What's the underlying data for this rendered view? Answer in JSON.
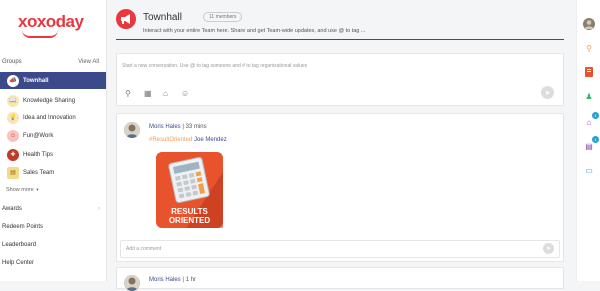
{
  "brand": {
    "logo_text": "xoxoday"
  },
  "sidebar": {
    "groups_label": "Groups",
    "view_all": "View All",
    "groups": [
      {
        "label": "Townhall",
        "active": true,
        "color": "#e8383d",
        "icon": "megaphone-icon"
      },
      {
        "label": "Knowledge Sharing",
        "active": false,
        "color": "#f5c542",
        "icon": "book-icon"
      },
      {
        "label": "Idea and Innovation",
        "active": false,
        "color": "#f39c12",
        "icon": "lightbulb-icon"
      },
      {
        "label": "Fun@Work",
        "active": false,
        "color": "#e74c3c",
        "icon": "fun-icon"
      },
      {
        "label": "Health Tips",
        "active": false,
        "color": "#c0392b",
        "icon": "health-icon"
      },
      {
        "label": "Sales Team",
        "active": false,
        "color": "#d4a017",
        "icon": "sales-icon"
      }
    ],
    "show_more": "Show more",
    "links": [
      "Awards",
      "Redeem Points",
      "Leaderboard",
      "Help Center"
    ]
  },
  "header": {
    "title": "Townhall",
    "members_badge": "11 members",
    "description": "Interact with your entire Team here. Share and get Team-wide updates, and use @ to tag ..."
  },
  "composer": {
    "placeholder": "Start a new conversation. Use @ to tag someone and # to tag organizational values",
    "tools": [
      "attachment-icon",
      "gif-icon",
      "gift-icon",
      "emoji-icon"
    ]
  },
  "post": {
    "author": "Moris Hales",
    "separator": "|",
    "time": "33 mins",
    "hashtag": "#ResultOriented",
    "mention": "Joe Mendez",
    "badge_lines": [
      "RESULTS",
      "ORIENTED"
    ],
    "badge_colors": {
      "primary": "#e8532d",
      "dark": "#b8351a"
    },
    "comment_placeholder": "Add a comment"
  },
  "post2": {
    "author": "Moris Hales",
    "separator": "|",
    "time": "1 hr"
  },
  "rightbar": {
    "items": [
      {
        "icon": "user-avatar-icon",
        "badge": ""
      },
      {
        "icon": "search-icon",
        "badge": ""
      },
      {
        "icon": "reward-icon",
        "badge": ""
      },
      {
        "icon": "profile-icon",
        "badge": ""
      },
      {
        "icon": "gift-box-icon",
        "badge": "1"
      },
      {
        "icon": "task-icon",
        "badge": "1"
      },
      {
        "icon": "chat-icon",
        "badge": ""
      }
    ]
  },
  "theme": {
    "accent": "#3c4a8c",
    "brand": "#e8383d"
  }
}
